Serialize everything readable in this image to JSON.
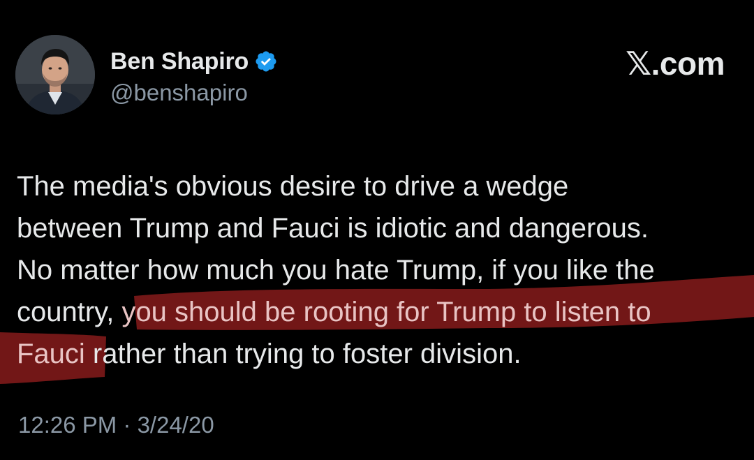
{
  "author": {
    "display_name": "Ben Shapiro",
    "handle": "@benshapiro",
    "verified": true,
    "avatar_icon": "profile-photo"
  },
  "brand": {
    "label": "𝕏.com"
  },
  "tweet": {
    "line_1": "The media's obvious desire to drive a wedge",
    "line_2": "between Trump and Fauci is idiotic and dangerous.",
    "line_3": "No matter how much you hate Trump, if you like the",
    "line_4_plain": "country, ",
    "line_4_highlight": "you should be rooting for Trump to listen to",
    "line_5_highlight": "Fauci",
    "line_5_plain": " rather than trying to foster division.",
    "highlight_color": "#8b1c1c"
  },
  "meta": {
    "timestamp": "12:26 PM · 3/24/20"
  },
  "colors": {
    "background": "#000000",
    "text_primary": "#e7e9ea",
    "text_secondary": "#8b98a5",
    "verified_badge": "#1d9bf0"
  }
}
